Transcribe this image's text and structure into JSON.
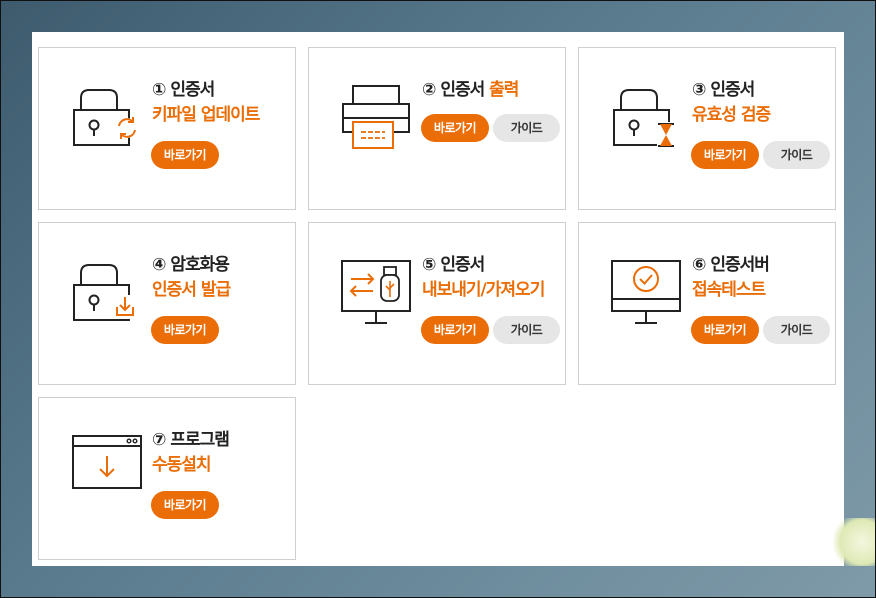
{
  "cards": [
    {
      "number": "①",
      "line1": "인증서",
      "line2": "키파일 업데이트",
      "go_label": "바로가기",
      "icon": "lock-refresh-icon"
    },
    {
      "number": "②",
      "line1": "인증서",
      "line1_accent": "출력",
      "go_label": "바로가기",
      "guide_label": "가이드",
      "icon": "printer-icon"
    },
    {
      "number": "③",
      "line1": "인증서",
      "line2": "유효성 검증",
      "go_label": "바로가기",
      "guide_label": "가이드",
      "icon": "lock-hourglass-icon"
    },
    {
      "number": "④",
      "line1": "암호화용",
      "line2": "인증서 발급",
      "go_label": "바로가기",
      "icon": "lock-download-icon"
    },
    {
      "number": "⑤",
      "line1": "인증서",
      "line2": "내보내기/가져오기",
      "go_label": "바로가기",
      "guide_label": "가이드",
      "icon": "monitor-usb-icon"
    },
    {
      "number": "⑥",
      "line1": "인증서버",
      "line2": "접속테스트",
      "go_label": "바로가기",
      "guide_label": "가이드",
      "icon": "monitor-check-icon"
    },
    {
      "number": "⑦",
      "line1": "프로그램",
      "line2": "수동설치",
      "go_label": "바로가기",
      "icon": "window-download-icon"
    }
  ],
  "colors": {
    "accent": "#ea6d07",
    "guide_bg": "#e6e6e6",
    "card_border": "#cfcfcf"
  }
}
